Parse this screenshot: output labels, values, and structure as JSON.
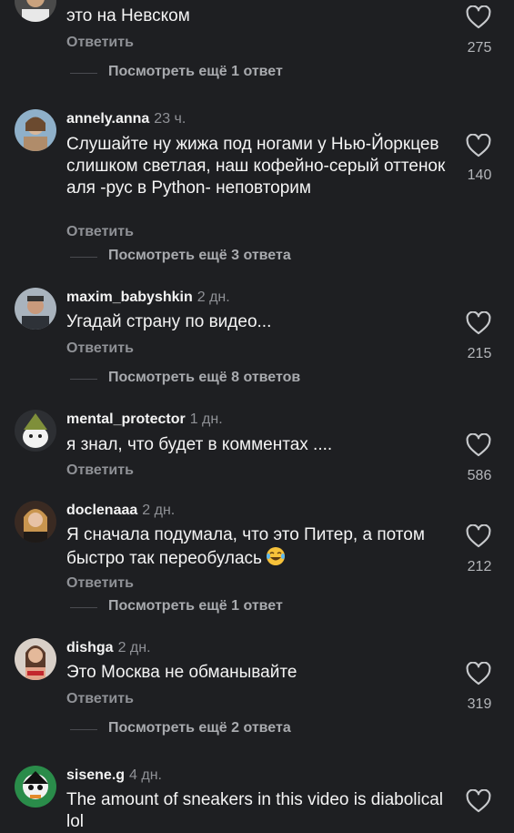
{
  "comments": [
    {
      "username": "",
      "time": "",
      "text": "это на Невском",
      "reply_label": "Ответить",
      "likes": "275",
      "more_label": "Посмотреть ещё 1 ответ"
    },
    {
      "username": "annely.anna",
      "time": "23 ч.",
      "text": "Слушайте ну жижа под ногами у Нью-Йоркцев слишком светлая, наш кофейно-серый оттенок аля -рус в Python- неповторим",
      "reply_label": "Ответить",
      "likes": "140",
      "more_label": "Посмотреть ещё 3 ответа"
    },
    {
      "username": "maxim_babyshkin",
      "time": "2 дн.",
      "text": "Угадай страну по видео...",
      "reply_label": "Ответить",
      "likes": "215",
      "more_label": "Посмотреть ещё 8 ответов"
    },
    {
      "username": "mental_protector",
      "time": "1 дн.",
      "text": "я знал, что будет в комментах ....",
      "reply_label": "Ответить",
      "likes": "586",
      "more_label": ""
    },
    {
      "username": "doclenaaa",
      "time": "2 дн.",
      "text": "Я сначала подумала, что это Питер, а потом быстро так переобулась",
      "reply_label": "Ответить",
      "likes": "212",
      "more_label": "Посмотреть ещё 1 ответ"
    },
    {
      "username": "dishga",
      "time": "2 дн.",
      "text": "Это Москва не обманывайте",
      "reply_label": "Ответить",
      "likes": "319",
      "more_label": "Посмотреть ещё 2 ответа"
    },
    {
      "username": "sisene.g",
      "time": "4 дн.",
      "text": "The amount of sneakers in this video is diabolical lol",
      "reply_label": "",
      "likes": "",
      "more_label": ""
    }
  ],
  "icons": {
    "like": "heart-outline-icon",
    "emoji": "laughing-tears-emoji-icon"
  },
  "colors": {
    "background": "#1e1f22",
    "muted": "#8f9196"
  }
}
